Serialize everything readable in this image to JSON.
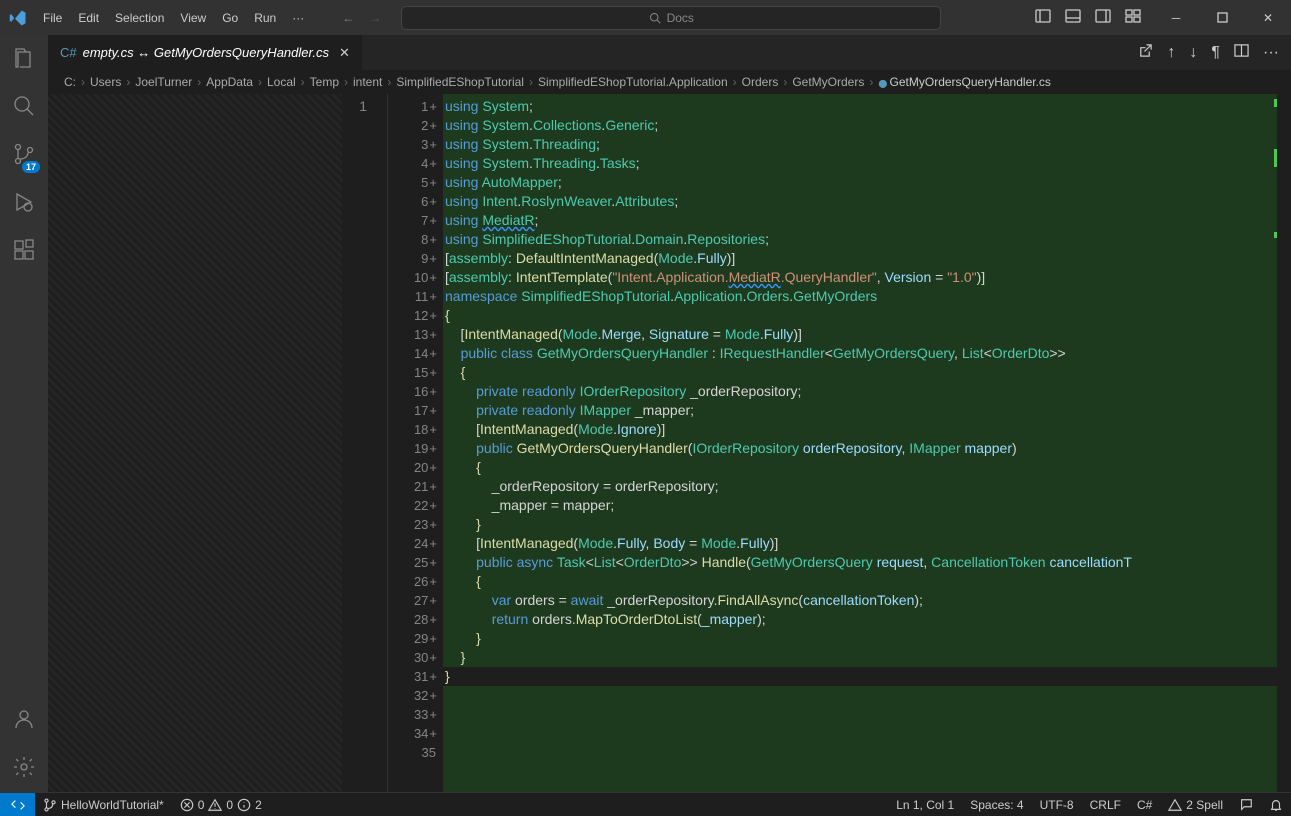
{
  "menu": [
    "File",
    "Edit",
    "Selection",
    "View",
    "Go",
    "Run",
    "···"
  ],
  "search": {
    "placeholder": "Docs"
  },
  "tab": {
    "label": "empty.cs ↔ GetMyOrdersQueryHandler.cs"
  },
  "breadcrumb": [
    "C:",
    "Users",
    "JoelTurner",
    "AppData",
    "Local",
    "Temp",
    "intent",
    "SimplifiedEShopTutorial",
    "SimplifiedEShopTutorial.Application",
    "Orders",
    "GetMyOrders",
    "GetMyOrdersQueryHandler.cs"
  ],
  "scm_badge": "17",
  "left_line": "1",
  "lines": [
    {
      "n": "1",
      "p": "+",
      "seg": [
        [
          "k",
          "using "
        ],
        [
          "t",
          "System"
        ],
        [
          "p",
          ";"
        ]
      ]
    },
    {
      "n": "2",
      "p": "+",
      "seg": [
        [
          "k",
          "using "
        ],
        [
          "t",
          "System"
        ],
        [
          "p",
          "."
        ],
        [
          "t",
          "Collections"
        ],
        [
          "p",
          "."
        ],
        [
          "t",
          "Generic"
        ],
        [
          "p",
          ";"
        ]
      ]
    },
    {
      "n": "3",
      "p": "+",
      "seg": [
        [
          "k",
          "using "
        ],
        [
          "t",
          "System"
        ],
        [
          "p",
          "."
        ],
        [
          "t",
          "Threading"
        ],
        [
          "p",
          ";"
        ]
      ]
    },
    {
      "n": "4",
      "p": "+",
      "seg": [
        [
          "k",
          "using "
        ],
        [
          "t",
          "System"
        ],
        [
          "p",
          "."
        ],
        [
          "t",
          "Threading"
        ],
        [
          "p",
          "."
        ],
        [
          "t",
          "Tasks"
        ],
        [
          "p",
          ";"
        ]
      ]
    },
    {
      "n": "5",
      "p": "+",
      "seg": [
        [
          "k",
          "using "
        ],
        [
          "t",
          "AutoMapper"
        ],
        [
          "p",
          ";"
        ]
      ]
    },
    {
      "n": "6",
      "p": "+",
      "seg": [
        [
          "k",
          "using "
        ],
        [
          "t",
          "Intent"
        ],
        [
          "p",
          "."
        ],
        [
          "t",
          "RoslynWeaver"
        ],
        [
          "p",
          "."
        ],
        [
          "t",
          "Attributes"
        ],
        [
          "p",
          ";"
        ]
      ]
    },
    {
      "n": "7",
      "p": "+",
      "seg": [
        [
          "k",
          "using "
        ],
        [
          "t wavy",
          "MediatR"
        ],
        [
          "p",
          ";"
        ]
      ]
    },
    {
      "n": "8",
      "p": "+",
      "seg": [
        [
          "k",
          "using "
        ],
        [
          "t",
          "SimplifiedEShopTutorial"
        ],
        [
          "p",
          "."
        ],
        [
          "t",
          "Domain"
        ],
        [
          "p",
          "."
        ],
        [
          "t",
          "Repositories"
        ],
        [
          "p",
          ";"
        ]
      ]
    },
    {
      "n": "9",
      "p": "+",
      "seg": [
        [
          "p",
          ""
        ]
      ]
    },
    {
      "n": "10",
      "p": "+",
      "seg": [
        [
          "p",
          "["
        ],
        [
          "t",
          "assembly"
        ],
        [
          "p",
          ": "
        ],
        [
          "m",
          "DefaultIntentManaged"
        ],
        [
          "p",
          "("
        ],
        [
          "t",
          "Mode"
        ],
        [
          "p",
          "."
        ],
        [
          "v",
          "Fully"
        ],
        [
          "p",
          ")]"
        ]
      ]
    },
    {
      "n": "11",
      "p": "+",
      "seg": [
        [
          "p",
          "["
        ],
        [
          "t",
          "assembly"
        ],
        [
          "p",
          ": "
        ],
        [
          "m",
          "IntentTemplate"
        ],
        [
          "p",
          "("
        ],
        [
          "s",
          "\"Intent.Application."
        ],
        [
          "s wavy",
          "MediatR"
        ],
        [
          "s",
          ".QueryHandler\""
        ],
        [
          "p",
          ", "
        ],
        [
          "v",
          "Version"
        ],
        [
          "p",
          " = "
        ],
        [
          "s",
          "\"1.0\""
        ],
        [
          "p",
          ")]"
        ]
      ]
    },
    {
      "n": "12",
      "p": "+",
      "seg": [
        [
          "p",
          ""
        ]
      ]
    },
    {
      "n": "13",
      "p": "+",
      "seg": [
        [
          "k",
          "namespace "
        ],
        [
          "t",
          "SimplifiedEShopTutorial"
        ],
        [
          "p",
          "."
        ],
        [
          "t",
          "Application"
        ],
        [
          "p",
          "."
        ],
        [
          "t",
          "Orders"
        ],
        [
          "p",
          "."
        ],
        [
          "t",
          "GetMyOrders"
        ]
      ]
    },
    {
      "n": "14",
      "p": "+",
      "seg": [
        [
          "m",
          "{"
        ]
      ]
    },
    {
      "n": "15",
      "p": "+",
      "seg": [
        [
          "p",
          "    ["
        ],
        [
          "m",
          "IntentManaged"
        ],
        [
          "p",
          "("
        ],
        [
          "t",
          "Mode"
        ],
        [
          "p",
          "."
        ],
        [
          "v",
          "Merge"
        ],
        [
          "p",
          ", "
        ],
        [
          "v",
          "Signature"
        ],
        [
          "p",
          " = "
        ],
        [
          "t",
          "Mode"
        ],
        [
          "p",
          "."
        ],
        [
          "v",
          "Fully"
        ],
        [
          "p",
          ")]"
        ]
      ]
    },
    {
      "n": "16",
      "p": "+",
      "seg": [
        [
          "p",
          "    "
        ],
        [
          "k",
          "public class "
        ],
        [
          "t",
          "GetMyOrdersQueryHandler"
        ],
        [
          "p",
          " : "
        ],
        [
          "t",
          "IRequestHandler"
        ],
        [
          "p",
          "<"
        ],
        [
          "t",
          "GetMyOrdersQuery"
        ],
        [
          "p",
          ", "
        ],
        [
          "t",
          "List"
        ],
        [
          "p",
          "<"
        ],
        [
          "t",
          "OrderDto"
        ],
        [
          "p",
          ">>"
        ]
      ]
    },
    {
      "n": "17",
      "p": "+",
      "seg": [
        [
          "p",
          "    "
        ],
        [
          "m",
          "{"
        ]
      ]
    },
    {
      "n": "18",
      "p": "+",
      "seg": [
        [
          "p",
          "        "
        ],
        [
          "k",
          "private readonly "
        ],
        [
          "t",
          "IOrderRepository"
        ],
        [
          "c",
          " _orderRepository;"
        ]
      ]
    },
    {
      "n": "19",
      "p": "+",
      "seg": [
        [
          "p",
          "        "
        ],
        [
          "k",
          "private readonly "
        ],
        [
          "t",
          "IMapper"
        ],
        [
          "c",
          " _mapper;"
        ]
      ]
    },
    {
      "n": "20",
      "p": "+",
      "seg": [
        [
          "p",
          ""
        ]
      ]
    },
    {
      "n": "21",
      "p": "+",
      "seg": [
        [
          "p",
          "        ["
        ],
        [
          "m",
          "IntentManaged"
        ],
        [
          "p",
          "("
        ],
        [
          "t",
          "Mode"
        ],
        [
          "p",
          "."
        ],
        [
          "v",
          "Ignore"
        ],
        [
          "p",
          ")]"
        ]
      ]
    },
    {
      "n": "22",
      "p": "+",
      "seg": [
        [
          "p",
          "        "
        ],
        [
          "k",
          "public "
        ],
        [
          "m",
          "GetMyOrdersQueryHandler"
        ],
        [
          "p",
          "("
        ],
        [
          "t",
          "IOrderRepository"
        ],
        [
          "p",
          " "
        ],
        [
          "v",
          "orderRepository"
        ],
        [
          "p",
          ", "
        ],
        [
          "t",
          "IMapper"
        ],
        [
          "p",
          " "
        ],
        [
          "v",
          "mapper"
        ],
        [
          "p",
          ")"
        ]
      ]
    },
    {
      "n": "23",
      "p": "+",
      "seg": [
        [
          "p",
          "        "
        ],
        [
          "m",
          "{"
        ]
      ]
    },
    {
      "n": "24",
      "p": "+",
      "seg": [
        [
          "p",
          "            _orderRepository = orderRepository;"
        ]
      ]
    },
    {
      "n": "25",
      "p": "+",
      "seg": [
        [
          "p",
          "            _mapper = mapper;"
        ]
      ]
    },
    {
      "n": "26",
      "p": "+",
      "seg": [
        [
          "p",
          "        "
        ],
        [
          "m",
          "}"
        ]
      ]
    },
    {
      "n": "27",
      "p": "+",
      "seg": [
        [
          "p",
          ""
        ]
      ]
    },
    {
      "n": "28",
      "p": "+",
      "seg": [
        [
          "p",
          "        ["
        ],
        [
          "m",
          "IntentManaged"
        ],
        [
          "p",
          "("
        ],
        [
          "t",
          "Mode"
        ],
        [
          "p",
          "."
        ],
        [
          "v",
          "Fully"
        ],
        [
          "p",
          ", "
        ],
        [
          "v",
          "Body"
        ],
        [
          "p",
          " = "
        ],
        [
          "t",
          "Mode"
        ],
        [
          "p",
          "."
        ],
        [
          "v",
          "Fully"
        ],
        [
          "p",
          ")]"
        ]
      ]
    },
    {
      "n": "29",
      "p": "+",
      "seg": [
        [
          "p",
          "        "
        ],
        [
          "k",
          "public async "
        ],
        [
          "t",
          "Task"
        ],
        [
          "p",
          "<"
        ],
        [
          "t",
          "List"
        ],
        [
          "p",
          "<"
        ],
        [
          "t",
          "OrderDto"
        ],
        [
          "p",
          ">> "
        ],
        [
          "m",
          "Handle"
        ],
        [
          "p",
          "("
        ],
        [
          "t",
          "GetMyOrdersQuery"
        ],
        [
          "p",
          " "
        ],
        [
          "v",
          "request"
        ],
        [
          "p",
          ", "
        ],
        [
          "t",
          "CancellationToken"
        ],
        [
          "p",
          " "
        ],
        [
          "v",
          "cancellationT"
        ]
      ]
    },
    {
      "n": "30",
      "p": "+",
      "seg": [
        [
          "p",
          "        "
        ],
        [
          "m",
          "{"
        ]
      ]
    },
    {
      "n": "31",
      "p": "+",
      "seg": [
        [
          "p",
          "            "
        ],
        [
          "k",
          "var"
        ],
        [
          "c",
          " orders = "
        ],
        [
          "k",
          "await"
        ],
        [
          "c",
          " _orderRepository."
        ],
        [
          "m",
          "FindAllAsync"
        ],
        [
          "p",
          "("
        ],
        [
          "v",
          "cancellationToken"
        ],
        [
          "p",
          ");"
        ]
      ]
    },
    {
      "n": "32",
      "p": "+",
      "seg": [
        [
          "p",
          "            "
        ],
        [
          "k",
          "return"
        ],
        [
          "c",
          " orders."
        ],
        [
          "m",
          "MapToOrderDtoList"
        ],
        [
          "p",
          "("
        ],
        [
          "v",
          "_mapper"
        ],
        [
          "p",
          ");"
        ]
      ]
    },
    {
      "n": "33",
      "p": "+",
      "seg": [
        [
          "p",
          "        "
        ],
        [
          "m",
          "}"
        ]
      ]
    },
    {
      "n": "34",
      "p": "+",
      "seg": [
        [
          "p",
          "    "
        ],
        [
          "m",
          "}"
        ]
      ]
    },
    {
      "n": "35",
      "p": "",
      "nochg": true,
      "seg": [
        [
          "m",
          "}"
        ]
      ]
    }
  ],
  "status": {
    "branch": "HelloWorldTutorial*",
    "errors": "0",
    "warnings": "0",
    "info": "2",
    "ln": "Ln 1, Col 1",
    "spaces": "Spaces: 4",
    "enc": "UTF-8",
    "eol": "CRLF",
    "lang": "C#",
    "spell": "2 Spell"
  }
}
